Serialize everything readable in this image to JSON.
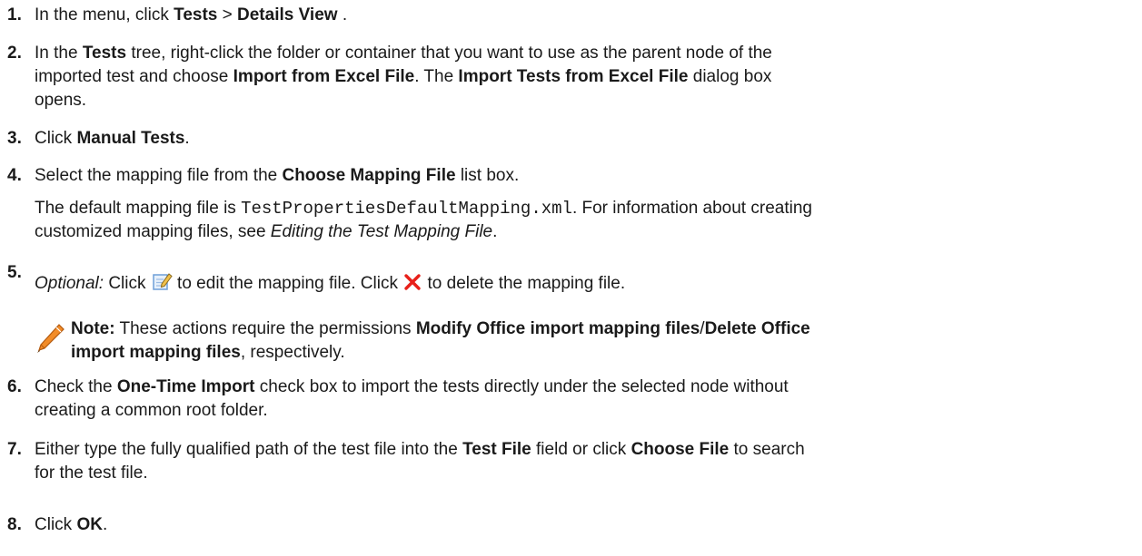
{
  "steps": [
    {
      "num": "1.",
      "t1": "In the menu, click ",
      "b1": "Tests",
      "t2": " > ",
      "b2": "Details View",
      "t3": " ."
    },
    {
      "num": "2.",
      "t1": "In the ",
      "b1": "Tests",
      "t2": " tree, right-click the folder or container that you want to use as the parent node of the",
      "t3": "imported test and choose ",
      "b2": "Import from Excel File",
      "t4": ". The ",
      "b3": "Import Tests from Excel File",
      "t5": " dialog box",
      "t6": "opens."
    },
    {
      "num": "3.",
      "t1": "Click ",
      "b1": "Manual Tests",
      "t2": "."
    },
    {
      "num": "4.",
      "t1": "Select the mapping file from the ",
      "b1": "Choose Mapping File",
      "t2": " list box.",
      "p2_t1": "The default mapping file is ",
      "p2_code": "TestPropertiesDefaultMapping.xml",
      "p2_t2": ". For information about creating",
      "p2_t3": "customized mapping files, see ",
      "p2_i1": "Editing the Test Mapping File",
      "p2_t4": "."
    },
    {
      "num": "5.",
      "i1": "Optional:",
      "t1": " Click ",
      "t2": " to edit the mapping file. Click ",
      "t3": " to delete the mapping file.",
      "edit_icon": "edit-icon",
      "delete_icon": "delete-icon",
      "note_icon": "pencil-note-icon",
      "note_b1": "Note:",
      "note_t1": " These actions require the permissions ",
      "note_b2": "Modify Office import mapping files",
      "note_t2": "/",
      "note_b3": "Delete Office",
      "note_b4": "import mapping files",
      "note_t3": ", respectively."
    },
    {
      "num": "6.",
      "t1": "Check the ",
      "b1": "One-Time Import",
      "t2": " check box to import the tests directly under the selected node without",
      "t3": "creating a common root folder."
    },
    {
      "num": "7.",
      "t1": "Either type the fully qualified path of the test file into the ",
      "b1": "Test File",
      "t2": " field or click ",
      "b2": "Choose File",
      "t3": " to search",
      "t4": "for the test file."
    },
    {
      "num": "8.",
      "t1": "Click ",
      "b1": "OK",
      "t2": "."
    }
  ],
  "colors": {
    "text": "#1a1a1a",
    "delete_icon": "#e8201a",
    "note_icon": "#f28c28"
  }
}
